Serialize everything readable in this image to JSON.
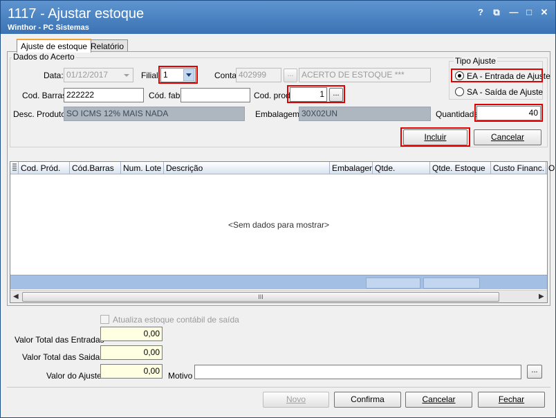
{
  "window": {
    "title": "1117 - Ajustar estoque",
    "subtitle": "Winthor - PC Sistemas",
    "controls": [
      "?",
      "⧉",
      "—",
      "□",
      "✕"
    ]
  },
  "tabs": [
    {
      "label": "Ajuste de estoque",
      "active": true
    },
    {
      "label": "Relatório",
      "active": false
    }
  ],
  "dados": {
    "group_title": "Dados do Acerto",
    "data_label": "Data:",
    "data_value": "01/12/2017",
    "filial_label": "Filial",
    "filial_value": "1",
    "conta_label": "Conta",
    "conta_value": "402999",
    "conta_desc": "ACERTO DE ESTOQUE ***",
    "cod_barras_label": "Cod. Barras:",
    "cod_barras_value": "222222",
    "cod_fab_label": "Cód. fab:",
    "cod_fab_value": "",
    "cod_prod_label": "Cod. prod",
    "cod_prod_value": "1",
    "desc_produto_label": "Desc. Produto:",
    "desc_produto_value": "SO ICMS 12% MAIS NADA",
    "embalagem_label": "Embalagem:",
    "embalagem_value": "30X02UN",
    "quantidade_label": "Quantidade",
    "quantidade_value": "40",
    "ellipsis": "..."
  },
  "tipo_ajuste": {
    "title": "Tipo Ajuste",
    "options": [
      {
        "label": "EA - Entrada de Ajuste",
        "selected": true
      },
      {
        "label": "SA - Saída de Ajuste",
        "selected": false
      }
    ]
  },
  "actions": {
    "incluir": "Incluir",
    "cancelar": "Cancelar"
  },
  "grid": {
    "columns": [
      "Cod. Pród.",
      "Cód.Barras",
      "Num. Lote",
      "Descrição",
      "Embalagem",
      "Qtde.",
      "Qtde. Estoque",
      "Custo Financ.",
      "Op"
    ],
    "empty_text": "<Sem dados para mostrar>",
    "scroll_thumb": "III"
  },
  "totals": {
    "atualiza_label": "Atualiza estoque contábil de saída",
    "entradas_label": "Valor Total das Entradas",
    "entradas_value": "0,00",
    "saidas_label": "Valor Total das Saidas",
    "saidas_value": "0,00",
    "ajuste_label": "Valor do Ajuste",
    "ajuste_value": "0,00",
    "motivo_label": "Motivo",
    "motivo_value": ""
  },
  "footer": {
    "novo": "Novo",
    "confirma": "Confirma",
    "cancelar": "Cancelar",
    "fechar": "Fechar"
  },
  "colors": {
    "titlebar": "#3a72b4",
    "highlight": "#e00000",
    "grid_footer": "#a4bfe4"
  }
}
